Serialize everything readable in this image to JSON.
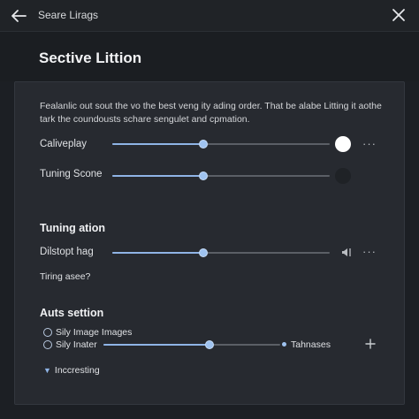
{
  "topbar": {
    "title": "Seare Lirags",
    "back_icon": "arrow-left-icon",
    "close_icon": "close-icon"
  },
  "header": {
    "title": "Sective Littion"
  },
  "panel": {
    "description": "Fealanlic out sout the vo the best veng ity ading order. That be alabe Litting it aothe tark the coundousts schare sengulet and cpmation.",
    "rows": [
      {
        "label": "Caliveplay",
        "value_fraction": 0.42,
        "knob": "white"
      },
      {
        "label": "Tuning Scone",
        "value_fraction": 0.42,
        "knob": "dark"
      }
    ],
    "tuning_section": {
      "title": "Tuning ation",
      "row_label": "Dilstopt hag",
      "value_fraction": 0.42,
      "trailing_icon": "volume-icon",
      "question": "Tiring asee?"
    },
    "auts_section": {
      "title": "Auts settion",
      "option1": "Sily Image Images",
      "option2": "Sily Inater",
      "slider_fraction": 0.6,
      "end_label": "Tahnases",
      "expander_label": "Incc​resting",
      "expander_text": "Inccresting"
    }
  },
  "colors": {
    "accent": "#8fb4e6",
    "background": "#1c1f24",
    "panel": "#272a30"
  }
}
